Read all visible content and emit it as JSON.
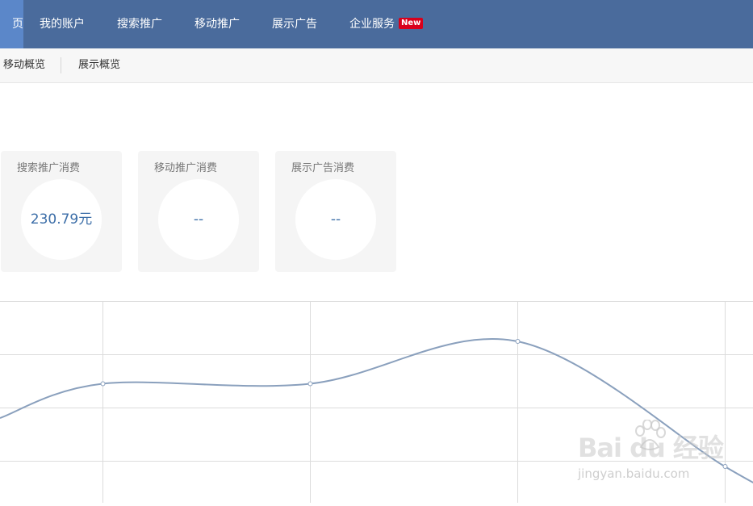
{
  "topnav": {
    "items": [
      {
        "label": "页",
        "active": true
      },
      {
        "label": "我的账户"
      },
      {
        "label": "搜索推广"
      },
      {
        "label": "移动推广"
      },
      {
        "label": "展示广告"
      },
      {
        "label": "企业服务"
      }
    ],
    "badge": "New"
  },
  "subnav": {
    "items": [
      "移动概览",
      "展示概览"
    ]
  },
  "cards": [
    {
      "title": "搜索推广消费",
      "value": "230.79元"
    },
    {
      "title": "移动推广消费",
      "value": "--"
    },
    {
      "title": "展示广告消费",
      "value": "--"
    }
  ],
  "colors": {
    "nav_bg": "#4a6b9c",
    "nav_active": "#5b87c9",
    "line": "#8aa0bd",
    "value_text": "#3c6ea8",
    "badge": "#d9001b"
  },
  "chart_data": {
    "type": "line",
    "grid": true,
    "series": [
      {
        "values": [
          0.58,
          0.41,
          0.41,
          0.2,
          0.82
        ]
      }
    ]
  },
  "watermark": {
    "main": "Bai du 经验",
    "sub": "jingyan.baidu.com"
  }
}
